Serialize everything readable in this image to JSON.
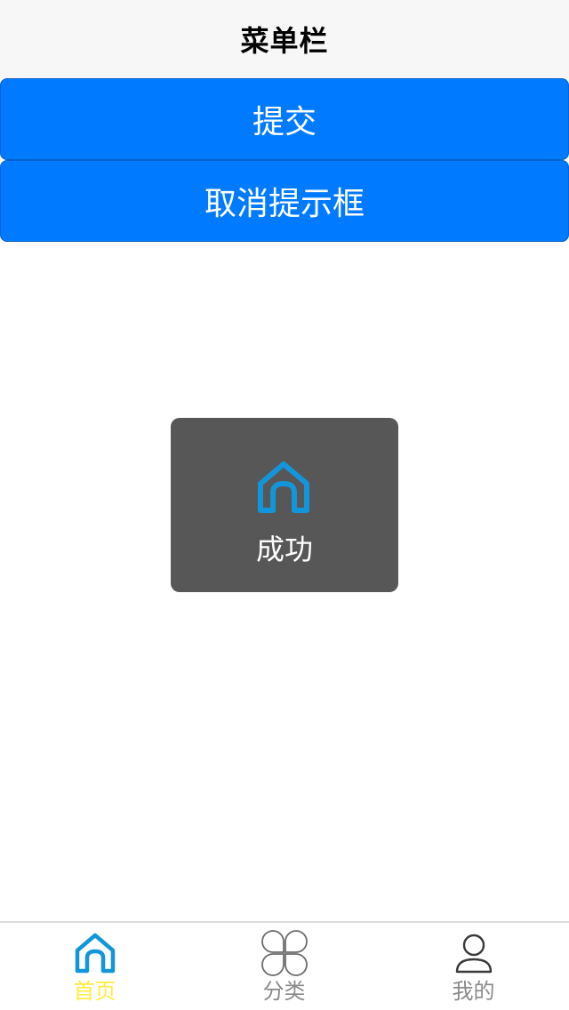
{
  "navbar": {
    "title": "菜单栏"
  },
  "buttons": {
    "submit_label": "提交",
    "cancel_toast_label": "取消提示框"
  },
  "toast": {
    "icon": "home-icon",
    "text": "成功"
  },
  "tabbar": {
    "items": [
      {
        "label": "首页",
        "icon": "home-icon",
        "active": true
      },
      {
        "label": "分类",
        "icon": "category-icon",
        "active": false
      },
      {
        "label": "我的",
        "icon": "user-icon",
        "active": false
      }
    ]
  },
  "colors": {
    "primary_button": "#007aff",
    "toast_background": "#575757",
    "icon_active": "#1296db",
    "tab_label_active": "#ffec3d",
    "tab_label_inactive": "#8a8a8a"
  }
}
